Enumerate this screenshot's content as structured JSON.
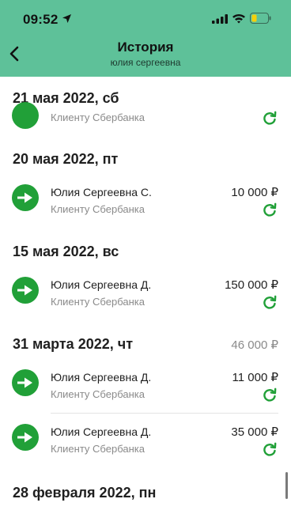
{
  "status_bar": {
    "time": "09:52"
  },
  "header": {
    "title": "История",
    "subtitle": "юлия сергеевна"
  },
  "colors": {
    "header_bg": "#5ec199",
    "brand_green": "#21a038",
    "muted": "#8a8a8a"
  },
  "sections": [
    {
      "date": "21 мая 2022, сб",
      "total": "",
      "rows": [
        {
          "name": "",
          "subtitle": "Клиенту Сбербанка",
          "amount": ""
        }
      ]
    },
    {
      "date": "20 мая 2022, пт",
      "total": "",
      "rows": [
        {
          "name": "Юлия Сергеевна С.",
          "subtitle": "Клиенту Сбербанка",
          "amount": "10 000 ₽"
        }
      ]
    },
    {
      "date": "15 мая 2022, вс",
      "total": "",
      "rows": [
        {
          "name": "Юлия Сергеевна Д.",
          "subtitle": "Клиенту Сбербанка",
          "amount": "150 000 ₽"
        }
      ]
    },
    {
      "date": "31 марта 2022, чт",
      "total": "46 000 ₽",
      "rows": [
        {
          "name": "Юлия Сергеевна Д.",
          "subtitle": "Клиенту Сбербанка",
          "amount": "11 000 ₽"
        },
        {
          "name": "Юлия Сергеевна Д.",
          "subtitle": "Клиенту Сбербанка",
          "amount": "35 000 ₽"
        }
      ]
    },
    {
      "date": "28 февраля 2022, пн",
      "total": "",
      "rows": []
    }
  ],
  "icons": {
    "back": "chevron-left-icon",
    "transfer": "arrow-right-icon",
    "repeat": "repeat-icon"
  }
}
